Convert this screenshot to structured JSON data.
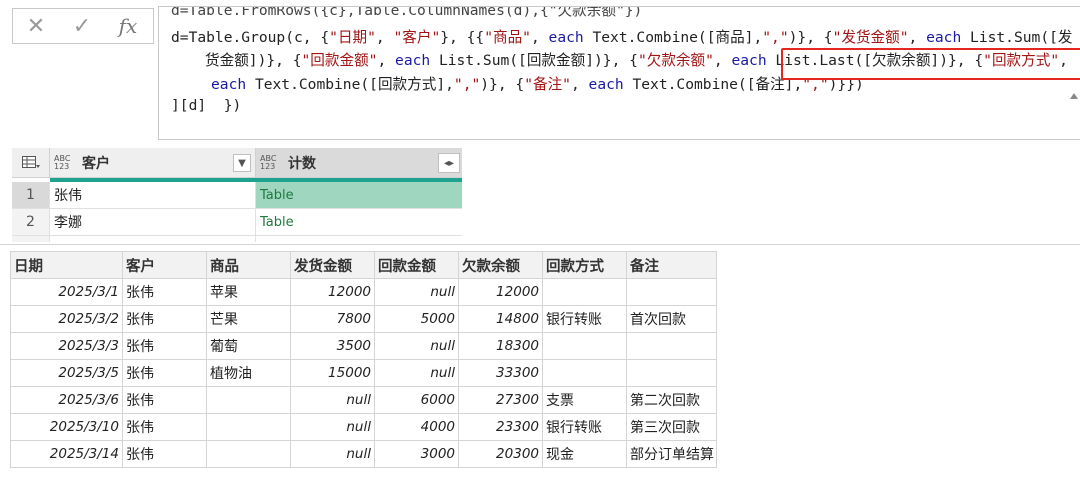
{
  "formula_bar": {
    "cancel_icon": "✕",
    "confirm_icon": "✓",
    "fx_label": "fx",
    "lines": [
      "d=Table.FromRows({c},Table.ColumnNames(d),{\"欠款余额\"})",
      "d=Table.Group(c, {\"日期\", \"客户\"}, {{\"商品\", each Text.Combine([商品],\",\")}, {\"发货金额\", each List.Sum([发",
      "货金额])}, {\"回款金额\", each List.Sum([回款金额])}, {\"欠款余额\", each List.Last([欠款余额])}, {\"回款方式\",",
      " each Text.Combine([回款方式],\",\")}, {\"备注\", each Text.Combine([备注],\",\")}})",
      "][d]  })"
    ],
    "highlight_color": "#e3261f"
  },
  "grouped_table": {
    "columns": [
      {
        "type_icon": "ABC 123",
        "label": "客户"
      },
      {
        "type_icon": "ABC 123",
        "label": "计数"
      }
    ],
    "rows": [
      {
        "num": "1",
        "customer": "张伟",
        "count": "Table"
      },
      {
        "num": "2",
        "customer": "李娜",
        "count": "Table"
      }
    ],
    "accent_color": "#1fa390"
  },
  "sheet": {
    "headers": [
      "日期",
      "客户",
      "商品",
      "发货金额",
      "回款金额",
      "欠款余额",
      "回款方式",
      "备注"
    ],
    "rows": [
      [
        "2025/3/1",
        "张伟",
        "苹果",
        "12000",
        "null",
        "12000",
        "",
        ""
      ],
      [
        "2025/3/2",
        "张伟",
        "芒果",
        "7800",
        "5000",
        "14800",
        "银行转账",
        "首次回款"
      ],
      [
        "2025/3/3",
        "张伟",
        "葡萄",
        "3500",
        "null",
        "18300",
        "",
        ""
      ],
      [
        "2025/3/5",
        "张伟",
        "植物油",
        "15000",
        "null",
        "33300",
        "",
        ""
      ],
      [
        "2025/3/6",
        "张伟",
        "",
        "null",
        "6000",
        "27300",
        "支票",
        "第二次回款"
      ],
      [
        "2025/3/10",
        "张伟",
        "",
        "null",
        "4000",
        "23300",
        "银行转账",
        "第三次回款"
      ],
      [
        "2025/3/14",
        "张伟",
        "",
        "null",
        "3000",
        "20300",
        "现金",
        "部分订单结算"
      ]
    ]
  }
}
